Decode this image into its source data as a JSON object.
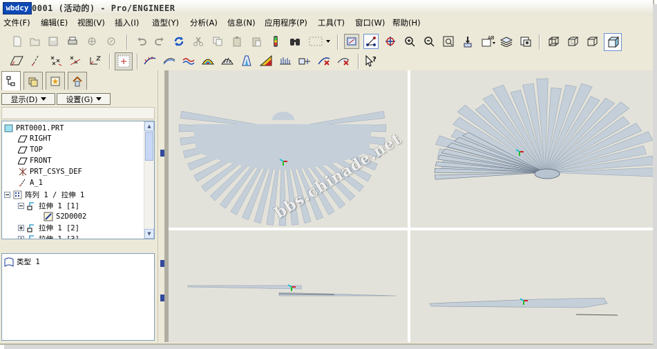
{
  "window": {
    "logo_text": "wbdcy",
    "title": "0001 (活动的) - Pro/ENGINEER"
  },
  "menu": {
    "items": [
      "文件(F)",
      "编辑(E)",
      "视图(V)",
      "插入(I)",
      "造型(Y)",
      "分析(A)",
      "信息(N)",
      "应用程序(P)",
      "工具(T)",
      "窗口(W)",
      "帮助(H)"
    ]
  },
  "left_panel": {
    "display_button": "显示(D)",
    "settings_button": "设置(G)",
    "tree": [
      {
        "label": "PRT0001.PRT",
        "icon": "part-icon"
      },
      {
        "label": "RIGHT",
        "icon": "datum-plane-icon"
      },
      {
        "label": "TOP",
        "icon": "datum-plane-icon"
      },
      {
        "label": "FRONT",
        "icon": "datum-plane-icon"
      },
      {
        "label": "PRT_CSYS_DEF",
        "icon": "csys-icon"
      },
      {
        "label": "A_1",
        "icon": "axis-icon"
      },
      {
        "label": "阵列 1 / 拉伸 1",
        "icon": "pattern-icon"
      },
      {
        "label": "拉伸 1 [1]",
        "icon": "extrude-icon"
      },
      {
        "label": "S2D0002",
        "icon": "sketch-icon"
      },
      {
        "label": "拉伸 1 [2]",
        "icon": "extrude-icon"
      },
      {
        "label": "拉伸 1 [3]",
        "icon": "extrude-icon"
      }
    ],
    "layer_label": "类型 1"
  },
  "watermark": "bbs.chinade.net",
  "colors": {
    "viewport_bg": "#e3e2da",
    "part_fill": "#c4cfd9",
    "part_edge": "#9aa8b6",
    "title_logo": "#0d49b6",
    "tree_border": "#7f9db9"
  }
}
